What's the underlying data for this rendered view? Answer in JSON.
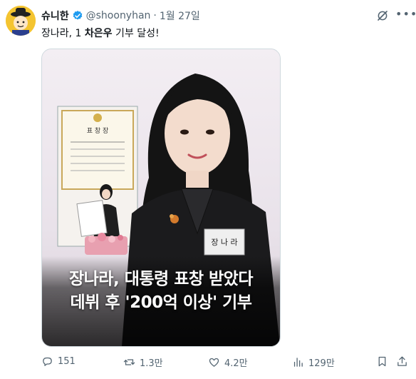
{
  "post": {
    "author_name": "슈니한",
    "handle": "@shoonyhan",
    "separator": "·",
    "date": "1월 27일",
    "text_before": "장나라, 1 ",
    "text_bold": "차은우",
    "text_after": " 기부 달성!"
  },
  "media": {
    "caption_line1": "장나라, 대통령 표창 받았다",
    "caption_line2": "데뷔 후 '200억 이상' 기부",
    "name_tag": "장 나 라",
    "certificate_title": "표 창 장"
  },
  "actions": {
    "reply_count": "151",
    "repost_count": "1.3만",
    "like_count": "4.2만",
    "view_count": "129만"
  },
  "colors": {
    "text": "#0f1419",
    "muted": "#536471",
    "verified": "#1d9bf0",
    "border": "#cfd9de"
  },
  "icons": [
    "verified-badge-icon",
    "grok-icon",
    "more-icon",
    "reply-icon",
    "repost-icon",
    "like-icon",
    "views-icon",
    "bookmark-icon",
    "share-icon"
  ]
}
